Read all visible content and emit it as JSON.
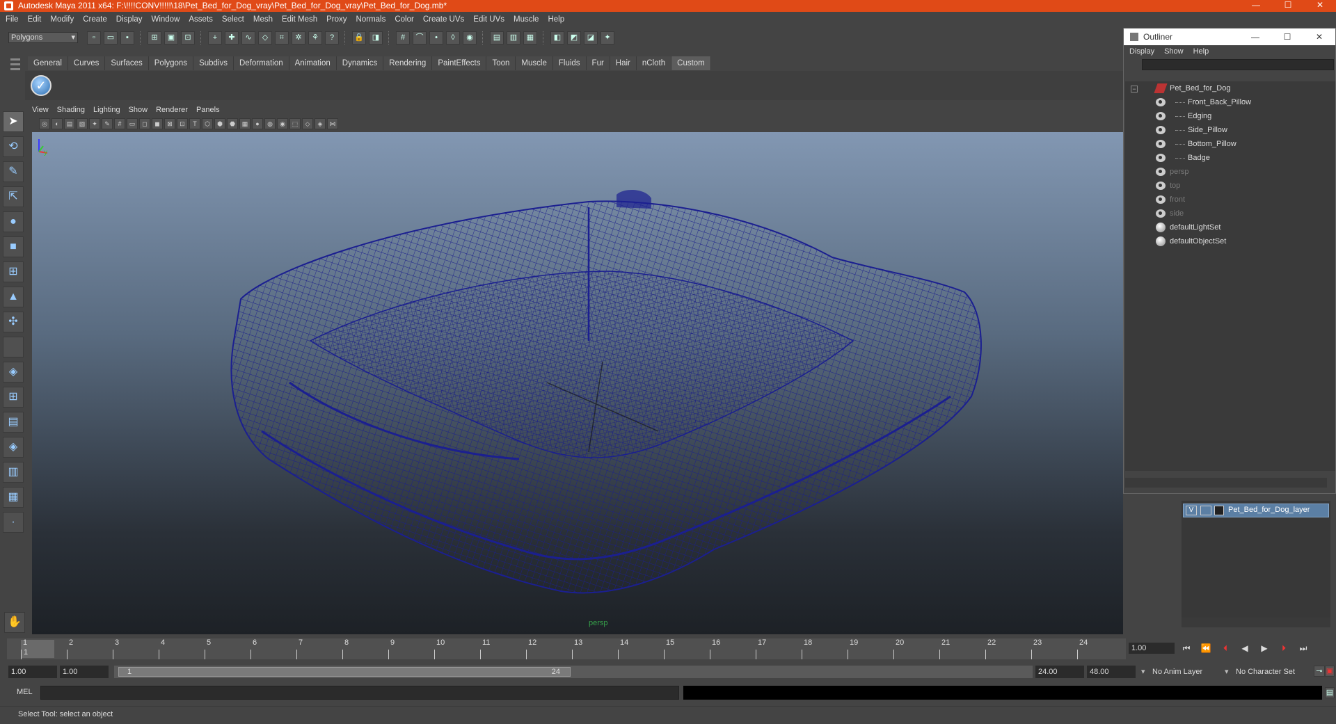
{
  "window": {
    "title": "Autodesk Maya 2011 x64: F:\\!!!!CONV!!!!!\\18\\Pet_Bed_for_Dog_vray\\Pet_Bed_for_Dog_vray\\Pet_Bed_for_Dog.mb*",
    "minimize": "—",
    "maximize": "☐",
    "close": "✕"
  },
  "menu": [
    "File",
    "Edit",
    "Modify",
    "Create",
    "Display",
    "Window",
    "Assets",
    "Select",
    "Mesh",
    "Edit Mesh",
    "Proxy",
    "Normals",
    "Color",
    "Create UVs",
    "Edit UVs",
    "Muscle",
    "Help"
  ],
  "status_line": {
    "mode": "Polygons"
  },
  "shelf": {
    "tabs": [
      "General",
      "Curves",
      "Surfaces",
      "Polygons",
      "Subdivs",
      "Deformation",
      "Animation",
      "Dynamics",
      "Rendering",
      "PaintEffects",
      "Toon",
      "Muscle",
      "Fluids",
      "Fur",
      "Hair",
      "nCloth",
      "Custom"
    ],
    "active_tab": "Custom"
  },
  "panel": {
    "menu": [
      "View",
      "Shading",
      "Lighting",
      "Show",
      "Renderer",
      "Panels"
    ],
    "camera": "persp"
  },
  "outliner": {
    "title": "Outliner",
    "menu": [
      "Display",
      "Show",
      "Help"
    ],
    "items": [
      {
        "label": "Pet_Bed_for_Dog",
        "type": "group"
      },
      {
        "label": "Front_Back_Pillow",
        "type": "mesh"
      },
      {
        "label": "Edging",
        "type": "mesh"
      },
      {
        "label": "Side_Pillow",
        "type": "mesh"
      },
      {
        "label": "Bottom_Pillow",
        "type": "mesh"
      },
      {
        "label": "Badge",
        "type": "mesh"
      },
      {
        "label": "persp",
        "type": "camera"
      },
      {
        "label": "top",
        "type": "camera"
      },
      {
        "label": "front",
        "type": "camera"
      },
      {
        "label": "side",
        "type": "camera"
      },
      {
        "label": "defaultLightSet",
        "type": "set"
      },
      {
        "label": "defaultObjectSet",
        "type": "set"
      }
    ]
  },
  "layers": {
    "visible_flag": "V",
    "name": "Pet_Bed_for_Dog_layer"
  },
  "timeline": {
    "ticks": [
      "1",
      "2",
      "3",
      "4",
      "5",
      "6",
      "7",
      "8",
      "9",
      "10",
      "11",
      "12",
      "13",
      "14",
      "15",
      "16",
      "17",
      "18",
      "19",
      "20",
      "21",
      "22",
      "23",
      "24"
    ],
    "current_frame_label": "1",
    "current_time": "1.00"
  },
  "range": {
    "start": "1.00",
    "playback_start": "1.00",
    "thumb_start": "1",
    "thumb_end": "24",
    "playback_end": "24.00",
    "end": "48.00",
    "anim_layer": "No Anim Layer",
    "character_set": "No Character Set"
  },
  "command_line": {
    "label": "MEL"
  },
  "help_line": "Select Tool: select an object"
}
